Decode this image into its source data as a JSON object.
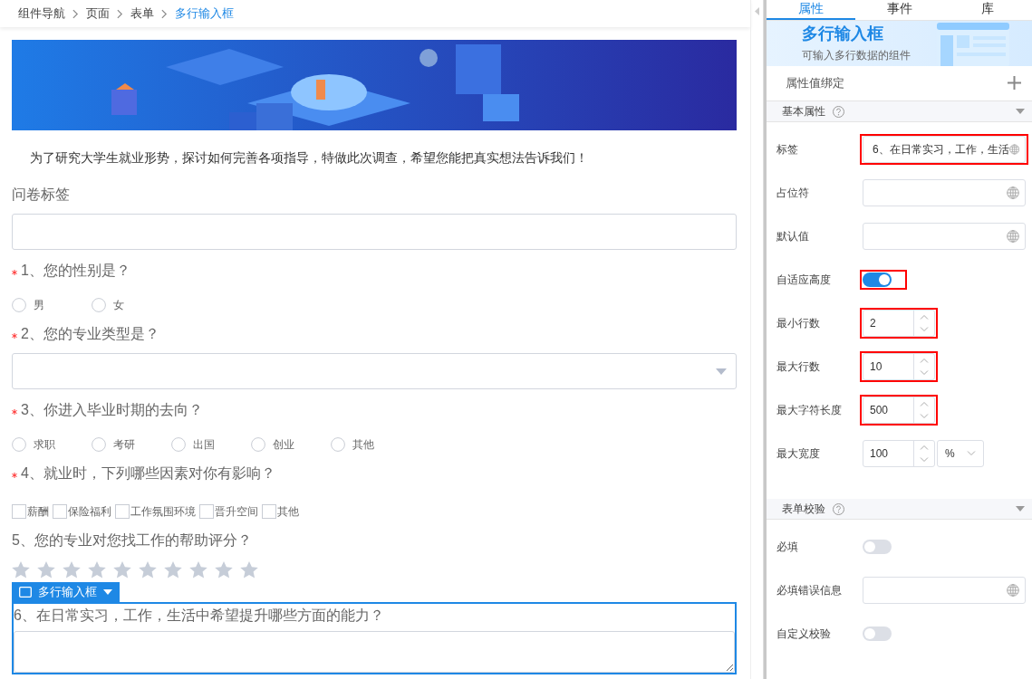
{
  "breadcrumb": [
    {
      "label": "组件导航",
      "current": false
    },
    {
      "label": "页面",
      "current": false
    },
    {
      "label": "表单",
      "current": false
    },
    {
      "label": "多行输入框",
      "current": true
    }
  ],
  "form": {
    "intro": "为了研究大学生就业形势，探讨如何完善各项指导，特做此次调查，希望您能把真实想法告诉我们！",
    "questions": [
      {
        "kind": "input",
        "label": "问卷标签",
        "required": false
      },
      {
        "kind": "radio",
        "label": "1、您的性别是？",
        "required": true,
        "options": [
          {
            "label": "男",
            "selected": false
          },
          {
            "label": "女",
            "selected": false
          }
        ]
      },
      {
        "kind": "select",
        "label": "2、您的专业类型是？",
        "required": true
      },
      {
        "kind": "radio",
        "label": "3、你进入毕业时期的去向？",
        "required": true,
        "options": [
          {
            "label": "求职",
            "selected": false
          },
          {
            "label": "考研",
            "selected": false
          },
          {
            "label": "出国",
            "selected": false
          },
          {
            "label": "创业",
            "selected": false
          },
          {
            "label": "其他",
            "selected": false
          }
        ]
      },
      {
        "kind": "checkbox",
        "label": "4、就业时，下列哪些因素对你有影响？",
        "required": true,
        "options": [
          {
            "label": "薪酬",
            "checked": false
          },
          {
            "label": "保险福利",
            "checked": false
          },
          {
            "label": "工作氛围环境",
            "checked": false
          },
          {
            "label": "晋升空间",
            "checked": false
          },
          {
            "label": "其他",
            "checked": false
          }
        ]
      },
      {
        "kind": "rating",
        "label": "5、您的专业对您找工作的帮助评分？",
        "required": false,
        "stars": 0
      },
      {
        "kind": "textarea",
        "label": "6、在日常实习，工作，生活中希望提升哪些方面的能力？",
        "required": false,
        "selected": true,
        "tag": "多行输入框"
      }
    ]
  },
  "panel": {
    "tabs": [
      {
        "label": "属性",
        "selected": true
      },
      {
        "label": "事件",
        "selected": false
      },
      {
        "label": "库",
        "selected": false
      }
    ],
    "header": {
      "title": "多行输入框",
      "subtitle": "可输入多行数据的组件"
    },
    "binding": {
      "label": "属性值绑定"
    },
    "sections": [
      {
        "title": "基本属性",
        "expanded": true,
        "fields": [
          {
            "kind": "text",
            "label": "标签",
            "value": "6、在日常实习，工作，生活",
            "highlighted": true
          },
          {
            "kind": "text",
            "label": "占位符",
            "highlighted": false
          },
          {
            "kind": "text",
            "label": "默认值",
            "highlighted": false
          },
          {
            "kind": "switch",
            "label": "自适应高度",
            "on": true,
            "highlighted": true
          },
          {
            "kind": "number",
            "label": "最小行数",
            "value": "2",
            "highlighted": true
          },
          {
            "kind": "number",
            "label": "最大行数",
            "value": "10",
            "highlighted": true
          },
          {
            "kind": "number",
            "label": "最大字符长度",
            "value": "500",
            "highlighted": true
          },
          {
            "kind": "number_unit",
            "label": "最大宽度",
            "value": "100",
            "unit": "%",
            "highlighted": false
          }
        ]
      },
      {
        "title": "表单校验",
        "expanded": true,
        "fields": [
          {
            "kind": "switch",
            "label": "必填",
            "on": false,
            "highlighted": false
          },
          {
            "kind": "text",
            "label": "必填错误信息",
            "highlighted": false
          },
          {
            "kind": "switch",
            "label": "自定义校验",
            "on": false,
            "highlighted": false
          }
        ]
      }
    ]
  }
}
